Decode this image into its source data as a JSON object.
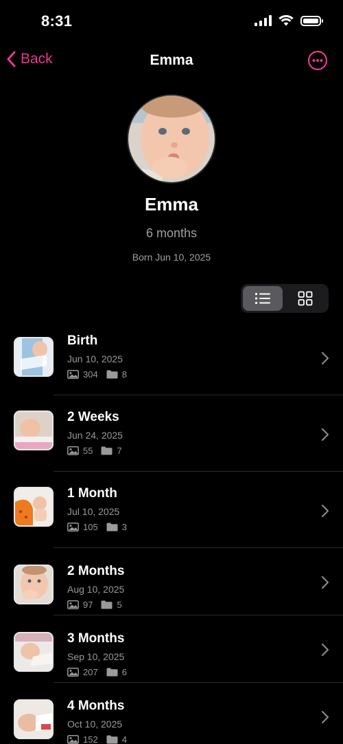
{
  "status": {
    "time": "8:31"
  },
  "nav": {
    "back_label": "Back",
    "title": "Emma"
  },
  "profile": {
    "name": "Emma",
    "age": "6 months",
    "born": "Born Jun 10, 2025"
  },
  "milestones": [
    {
      "title": "Birth",
      "date": "Jun 10, 2025",
      "photos": "304",
      "folders": "8"
    },
    {
      "title": "2 Weeks",
      "date": "Jun 24, 2025",
      "photos": "55",
      "folders": "7"
    },
    {
      "title": "1 Month",
      "date": "Jul 10, 2025",
      "photos": "105",
      "folders": "3"
    },
    {
      "title": "2 Months",
      "date": "Aug 10, 2025",
      "photos": "97",
      "folders": "5"
    },
    {
      "title": "3 Months",
      "date": "Sep 10, 2025",
      "photos": "207",
      "folders": "6"
    },
    {
      "title": "4 Months",
      "date": "Oct 10, 2025",
      "photos": "152",
      "folders": "4"
    }
  ],
  "colors": {
    "accent": "#e6388f",
    "background": "#000000",
    "secondary_text": "#9a9a9a"
  }
}
